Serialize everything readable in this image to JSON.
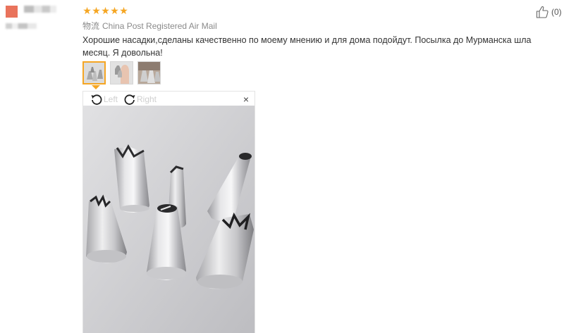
{
  "review": {
    "rating": 5,
    "shipping_label": "物流",
    "shipping_method": "China Post Registered Air Mail",
    "text": "Хорошие насадки,сделаны качественно по моему мнению и для дома подойдут. Посылка до Мурманска шла месяц. Я довольна!",
    "helpful_count": "(0)"
  },
  "stars": [
    "★",
    "★",
    "★",
    "★",
    "★"
  ],
  "thumbnails": [
    {
      "name": "piping-tips",
      "active": true
    },
    {
      "name": "hand-with-tips",
      "active": false
    },
    {
      "name": "tips-closeup",
      "active": false
    }
  ],
  "viewer": {
    "rotate_left_label": "Left",
    "rotate_right_label": "Right",
    "close_glyph": "×"
  },
  "colors": {
    "star": "#f5a623",
    "avatar": "#e9735c",
    "active_border": "#f5a623"
  },
  "icons": [
    "thumbs-up-icon",
    "rotate-left-icon",
    "rotate-right-icon",
    "close-icon",
    "star-icon"
  ]
}
